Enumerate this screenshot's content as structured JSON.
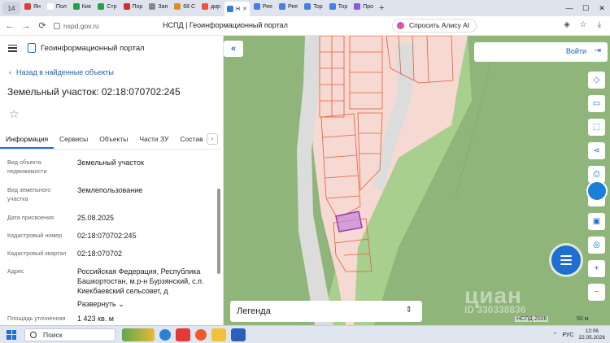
{
  "browser": {
    "tab_count": "14",
    "tabs": [
      {
        "label": "Ян",
        "color": "#e53935"
      },
      {
        "label": "Пол",
        "color": "#ffffff"
      },
      {
        "label": "Киє",
        "color": "#2e9c4a"
      },
      {
        "label": "Стр",
        "color": "#2e9c4a"
      },
      {
        "label": "Пор",
        "color": "#d32f2f"
      },
      {
        "label": "Зап",
        "color": "#888888"
      },
      {
        "label": "68 С",
        "color": "#e08a2a"
      },
      {
        "label": "дир",
        "color": "#f0533a"
      },
      {
        "label": "Н",
        "color": "#3a7bd5",
        "active": true
      },
      {
        "label": "Рее",
        "color": "#4a7de0"
      },
      {
        "label": "Рее",
        "color": "#4a7de0"
      },
      {
        "label": "Тор",
        "color": "#4a7de0"
      },
      {
        "label": "Тор",
        "color": "#4a7de0"
      },
      {
        "label": "Про",
        "color": "#8a5cd1"
      }
    ],
    "url": "nspd.gov.ru",
    "page_title": "НСПД | Геоинформационный портал",
    "alice_button": "Спросить Алису AI"
  },
  "portal": {
    "name": "Геоинформационный портал",
    "back_link": "Назад в найденные объекты",
    "parcel_title": "Земельный участок: 02:18:070702:245",
    "tabs": [
      "Информация",
      "Сервисы",
      "Объекты",
      "Части ЗУ",
      "Состав"
    ],
    "active_tab": 0,
    "fields": [
      {
        "label": "Вид объекта недвижимости",
        "value": "Земельный участок"
      },
      {
        "label": "Вид земельного участка",
        "value": "Землепользование"
      },
      {
        "label": "Дата присвоения",
        "value": "25.08.2025"
      },
      {
        "label": "Кадастровый номер",
        "value": "02:18:070702:245"
      },
      {
        "label": "Кадастровый квартал",
        "value": "02:18:070702"
      },
      {
        "label": "Адрес",
        "value": "Российская Федерация, Республика Башкортостан, м.р-н Бурзянский, с.п. Киекбаевский сельсовет, д"
      },
      {
        "label": "Площадь уточненная",
        "value": "1 423 кв. м"
      }
    ],
    "expand_link": "Развернуть"
  },
  "map": {
    "login": "Войти",
    "legend": "Легенда",
    "watermark": "циан",
    "watermark_id": "ID 330338836",
    "attribution": "НСПД 2026",
    "scale": "50 м",
    "colors": {
      "forest": "#8fb57a",
      "meadow": "#a9cf8e",
      "settlement": "#f6d9d2",
      "road": "#dcdcdc",
      "parcel_line": "#e0603a",
      "selected_parcel": "#9b3bb5"
    }
  },
  "taskbar": {
    "search": "Поиск",
    "lang": "РУС",
    "time": "12:06",
    "date": "22.05.2026"
  }
}
